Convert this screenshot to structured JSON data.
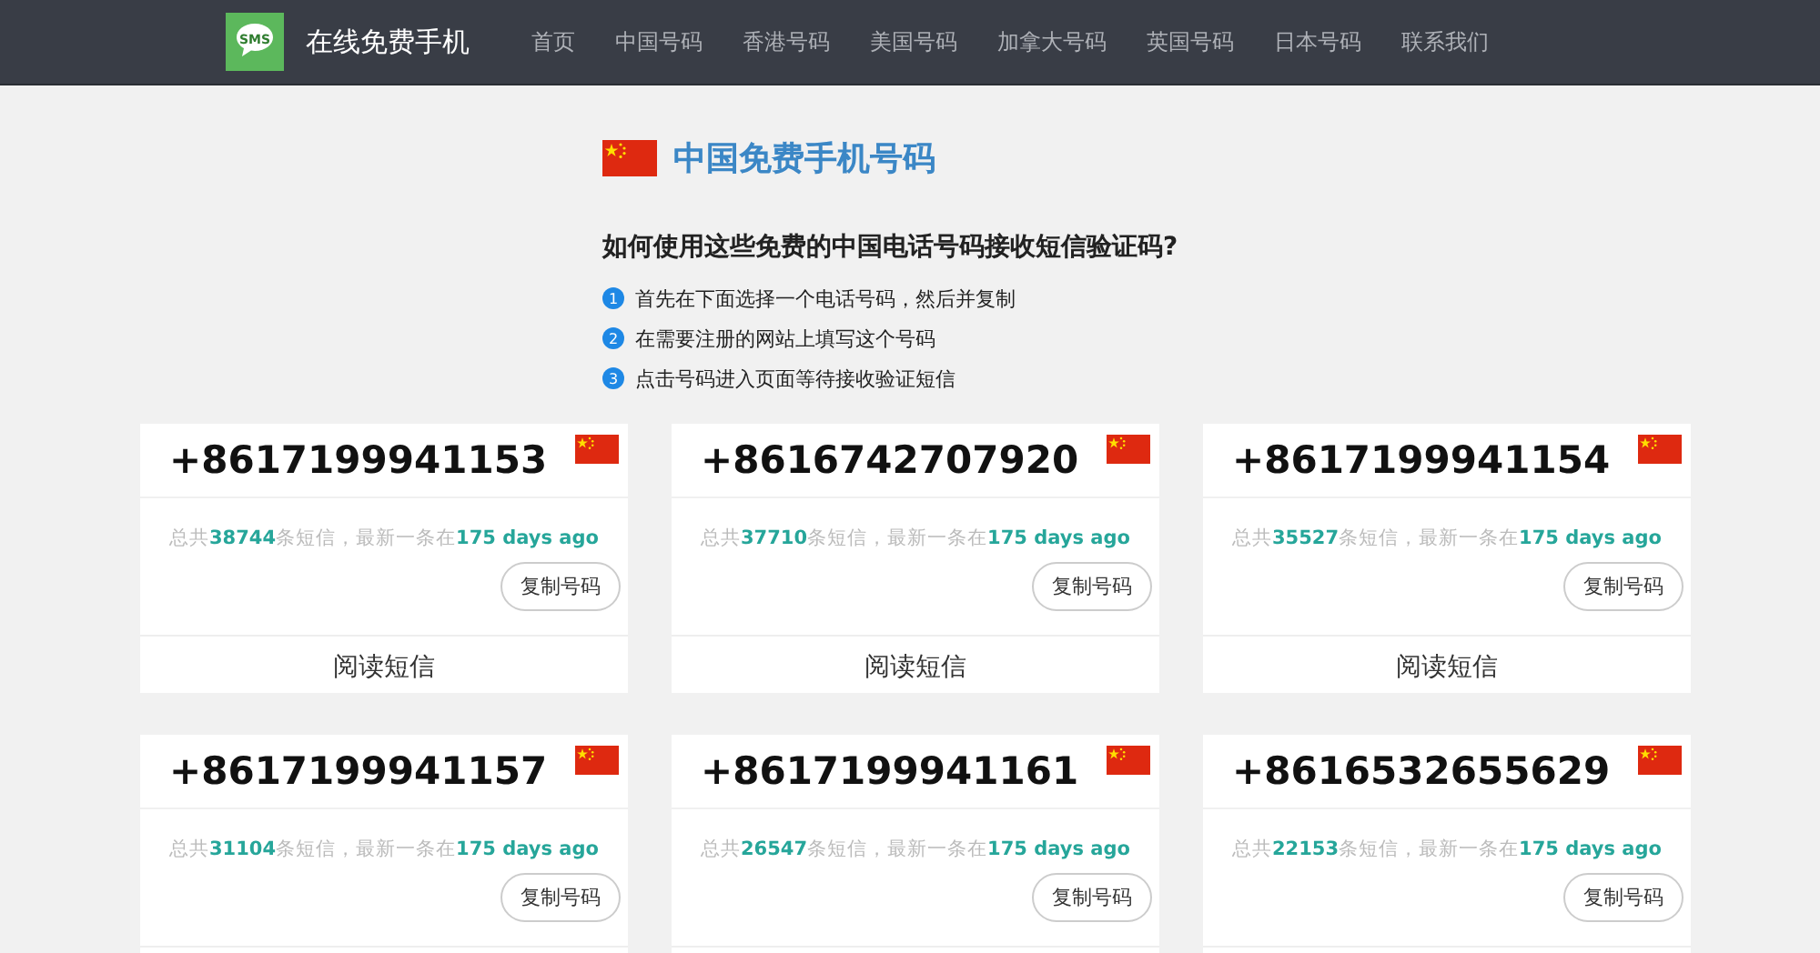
{
  "brand": {
    "title": "在线免费手机",
    "logo_text": "SMS"
  },
  "nav": [
    {
      "label": "首页"
    },
    {
      "label": "中国号码"
    },
    {
      "label": "香港号码"
    },
    {
      "label": "美国号码"
    },
    {
      "label": "加拿大号码"
    },
    {
      "label": "英国号码"
    },
    {
      "label": "日本号码"
    },
    {
      "label": "联系我们"
    }
  ],
  "heading": "中国免费手机号码",
  "howto": {
    "title": "如何使用这些免费的中国电话号码接收短信验证码?",
    "steps": [
      {
        "marker": "1",
        "text": "首先在下面选择一个电话号码，然后并复制"
      },
      {
        "marker": "2",
        "text": "在需要注册的网站上填写这个号码"
      },
      {
        "marker": "3",
        "text": "点击号码进入页面等待接收验证短信"
      }
    ]
  },
  "cards": [
    {
      "number": "+8617199941153",
      "pre": "总共",
      "count": "38744",
      "mid": "条短信，最新一条在",
      "time": "175 days ago",
      "copy": "复制号码",
      "read": "阅读短信"
    },
    {
      "number": "+8616742707920",
      "pre": "总共",
      "count": "37710",
      "mid": "条短信，最新一条在",
      "time": "175 days ago",
      "copy": "复制号码",
      "read": "阅读短信"
    },
    {
      "number": "+8617199941154",
      "pre": "总共",
      "count": "35527",
      "mid": "条短信，最新一条在",
      "time": "175 days ago",
      "copy": "复制号码",
      "read": "阅读短信"
    },
    {
      "number": "+8617199941157",
      "pre": "总共",
      "count": "31104",
      "mid": "条短信，最新一条在",
      "time": "175 days ago",
      "copy": "复制号码"
    },
    {
      "number": "+8617199941161",
      "pre": "总共",
      "count": "26547",
      "mid": "条短信，最新一条在",
      "time": "175 days ago",
      "copy": "复制号码"
    },
    {
      "number": "+8616532655629",
      "pre": "总共",
      "count": "22153",
      "mid": "条短信，最新一条在",
      "time": "175 days ago",
      "copy": "复制号码"
    }
  ]
}
